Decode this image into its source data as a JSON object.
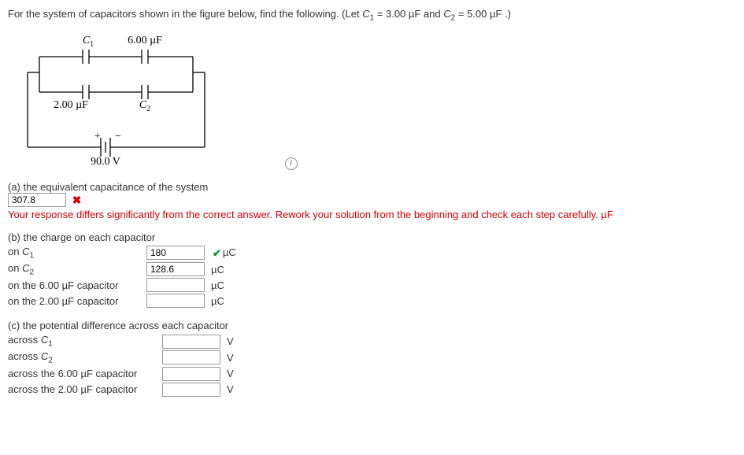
{
  "question": {
    "intro": "For the system of capacitors shown in the figure below, find the following. (Let ",
    "c1_label": "C",
    "c1_sub": "1",
    "eq": " = ",
    "c1_val": "3.00 µF",
    "and": " and ",
    "c2_label": "C",
    "c2_sub": "2",
    "c2_val": "5.00 µF",
    "end": ".)"
  },
  "circuit": {
    "C1": "C",
    "C1sub": "1",
    "cap6": "6.00 µF",
    "cap2": "2.00 µF",
    "C2": "C",
    "C2sub": "2",
    "plus": "+",
    "minus": "−",
    "voltage": "90.0 V"
  },
  "parts": {
    "a": {
      "prompt": "(a) the equivalent capacitance of the system",
      "value": "307.8",
      "feedback": "Your response differs significantly from the correct answer. Rework your solution from the beginning and check each step carefully. µF"
    },
    "b": {
      "prompt": "(b) the charge on each capacitor",
      "rows": [
        {
          "label_pre": "on ",
          "label_var": "C",
          "label_sub": "1",
          "value": "180",
          "status": "correct",
          "unit": "µC"
        },
        {
          "label_pre": "on ",
          "label_var": "C",
          "label_sub": "2",
          "value": "128.6",
          "status": "none",
          "unit": "µC"
        },
        {
          "label_full": "on the 6.00 µF capacitor",
          "value": "",
          "status": "none",
          "unit": "µC"
        },
        {
          "label_full": "on the 2.00 µF capacitor",
          "value": "",
          "status": "none",
          "unit": "µC"
        }
      ]
    },
    "c": {
      "prompt": "(c) the potential difference across each capacitor",
      "rows": [
        {
          "label_pre": "across ",
          "label_var": "C",
          "label_sub": "1",
          "value": "",
          "unit": "V"
        },
        {
          "label_pre": "across ",
          "label_var": "C",
          "label_sub": "2",
          "value": "",
          "unit": "V"
        },
        {
          "label_full": "across the 6.00 µF capacitor",
          "value": "",
          "unit": "V"
        },
        {
          "label_full": "across the 2.00 µF capacitor",
          "value": "",
          "unit": "V"
        }
      ]
    }
  }
}
